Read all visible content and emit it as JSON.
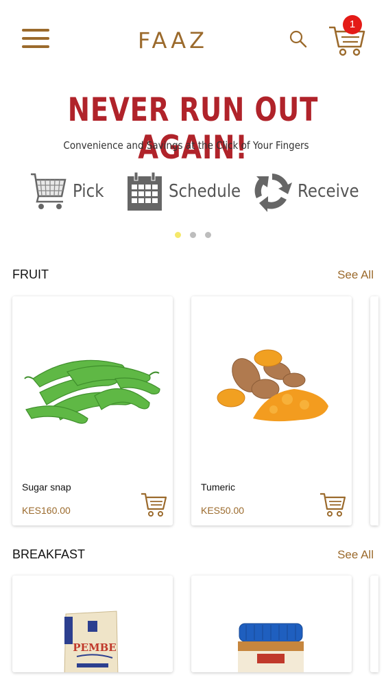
{
  "header": {
    "logo_text": "FAAZ",
    "cart_count": "1",
    "icons": {
      "menu": "hamburger-menu-icon",
      "search": "search-icon",
      "cart": "shopping-cart-icon"
    },
    "brand_color": "#9b6a2c"
  },
  "banner": {
    "headline": "NEVER RUN OUT AGAIN!",
    "subheadline": "Convenience and Savings at the Click of Your Fingers",
    "steps": [
      {
        "label": "Pick",
        "icon": "shopping-cart-icon"
      },
      {
        "label": "Schedule",
        "icon": "calendar-icon"
      },
      {
        "label": "Receive",
        "icon": "recycle-arrows-icon"
      }
    ],
    "carousel": {
      "total": 3,
      "active_index": 0
    },
    "headline_color": "#b0232a"
  },
  "sections": [
    {
      "title": "FRUIT",
      "see_all": "See All",
      "products": [
        {
          "name": "Sugar snap",
          "price": "KES160.00",
          "image": "sugar-snap-peas-image"
        },
        {
          "name": "Tumeric",
          "price": "KES50.00",
          "image": "turmeric-root-image"
        }
      ]
    },
    {
      "title": "BREAKFAST",
      "see_all": "See All",
      "products": [
        {
          "name": "",
          "price": "",
          "image": "pembe-flour-bag-image",
          "package_text": "PEMBE"
        },
        {
          "name": "",
          "price": "",
          "image": "peanut-butter-jar-image"
        }
      ]
    }
  ]
}
